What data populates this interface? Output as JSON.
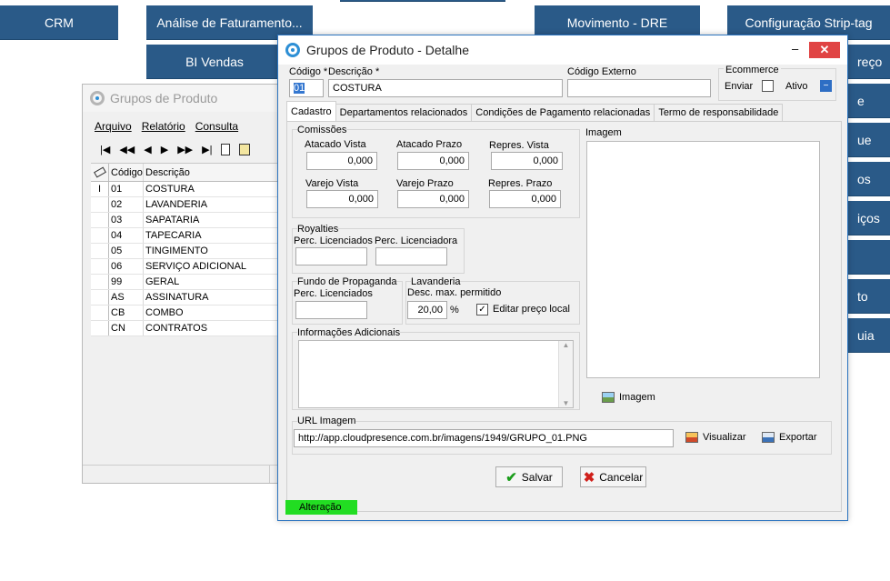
{
  "background_tiles": {
    "crm": "CRM",
    "analise": "Análise de Faturamento...",
    "bi_vendas": "BI Vendas",
    "movimento": "Movimento - DRE",
    "config": "Configuração Strip-tag",
    "r1": "reço",
    "r2": "e",
    "r3": "ue",
    "r4": "os",
    "r5": "iços",
    "r6": "to",
    "r7": "uia"
  },
  "back_window": {
    "title": "Grupos de Produto",
    "menu": [
      "Arquivo",
      "Relatório",
      "Consulta"
    ],
    "nav": [
      "|◀",
      "◀◀",
      "◀",
      "▶",
      "▶▶",
      "▶|"
    ],
    "columns": [
      "Código",
      "Descrição"
    ],
    "rows": [
      {
        "code": "01",
        "desc": "COSTURA"
      },
      {
        "code": "02",
        "desc": "LAVANDERIA"
      },
      {
        "code": "03",
        "desc": "SAPATARIA"
      },
      {
        "code": "04",
        "desc": "TAPECARIA"
      },
      {
        "code": "05",
        "desc": "TINGIMENTO"
      },
      {
        "code": "06",
        "desc": "SERVIÇO ADICIONAL"
      },
      {
        "code": "99",
        "desc": "GERAL"
      },
      {
        "code": "AS",
        "desc": "ASSINATURA"
      },
      {
        "code": "CB",
        "desc": "COMBO"
      },
      {
        "code": "CN",
        "desc": "CONTRATOS"
      }
    ]
  },
  "dialog": {
    "title": "Grupos de Produto - Detalhe",
    "minimize": "–",
    "close": "✕",
    "codigo_label": "Código *",
    "codigo_value": "01",
    "descricao_label": "Descrição *",
    "descricao_value": "COSTURA",
    "codigo_externo_label": "Código Externo",
    "codigo_externo_value": "",
    "ecommerce_label": "Ecommerce",
    "enviar_label": "Enviar",
    "ativo_label": "Ativo",
    "tabs": [
      "Cadastro",
      "Departamentos relacionados",
      "Condições de Pagamento relacionadas",
      "Termo de responsabilidade"
    ],
    "comissoes": {
      "title": "Comissões",
      "atacado_vista_label": "Atacado Vista",
      "atacado_vista": "0,000",
      "atacado_prazo_label": "Atacado Prazo",
      "atacado_prazo": "0,000",
      "repres_vista_label": "Repres. Vista",
      "repres_vista": "0,000",
      "varejo_vista_label": "Varejo Vista",
      "varejo_vista": "0,000",
      "varejo_prazo_label": "Varejo Prazo",
      "varejo_prazo": "0,000",
      "repres_prazo_label": "Repres. Prazo",
      "repres_prazo": "0,000"
    },
    "royalties": {
      "title": "Royalties",
      "licenciados_label": "Perc. Licenciados",
      "licenciadora_label": "Perc. Licenciadora"
    },
    "fundo": {
      "title": "Fundo de Propaganda",
      "licenciados_label": "Perc. Licenciados"
    },
    "lavanderia": {
      "title": "Lavanderia",
      "desc_label": "Desc. max. permitido",
      "desc_value": "20,00",
      "percent": "%",
      "editar_label": "Editar preço local"
    },
    "info_label": "Informações Adicionais",
    "imagem_label": "Imagem",
    "imagem_button": "Imagem",
    "url_label": "URL Imagem",
    "url_value": "http://app.cloudpresence.com.br/imagens/1949/GRUPO_01.PNG",
    "visualizar": "Visualizar",
    "exportar": "Exportar",
    "salvar": "Salvar",
    "cancelar": "Cancelar",
    "status": "Alteração"
  }
}
